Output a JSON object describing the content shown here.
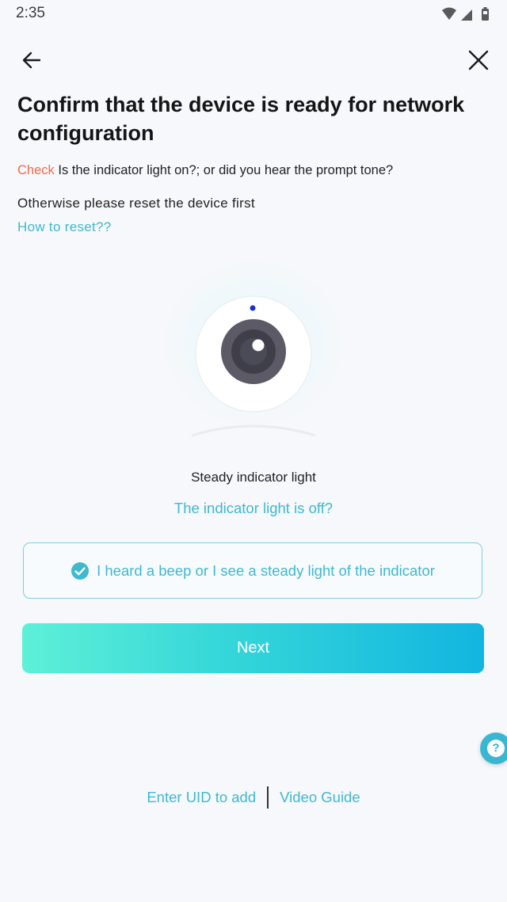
{
  "status_bar": {
    "time": "2:35",
    "icons": [
      "wifi-icon",
      "signal-icon",
      "battery-icon"
    ]
  },
  "nav": {
    "back_icon": "arrow-left-icon",
    "close_icon": "close-icon"
  },
  "title": "Confirm that the device is ready for network configuration",
  "check_line": {
    "highlight": "Check",
    "text": " Is the indicator light on?; or did you hear the prompt tone?"
  },
  "reset_hint": "Otherwise please reset the device first",
  "reset_link": "How to reset??",
  "indicator": {
    "caption": "Steady indicator light",
    "off_link": "The indicator light is off?"
  },
  "confirm": {
    "checked": true,
    "label": "I heard a beep or I see a steady light of the indicator"
  },
  "next_button": "Next",
  "help_icon": "question-mark-icon",
  "help_glyph": "?",
  "footer": {
    "uid_link": "Enter UID to add",
    "video_link": "Video Guide"
  },
  "colors": {
    "accent": "#3fb8d0",
    "check_highlight": "#f06a4a",
    "gradient_start": "#5ef0d8",
    "gradient_end": "#12b5e0",
    "indicator_led": "#1a2fd6"
  }
}
